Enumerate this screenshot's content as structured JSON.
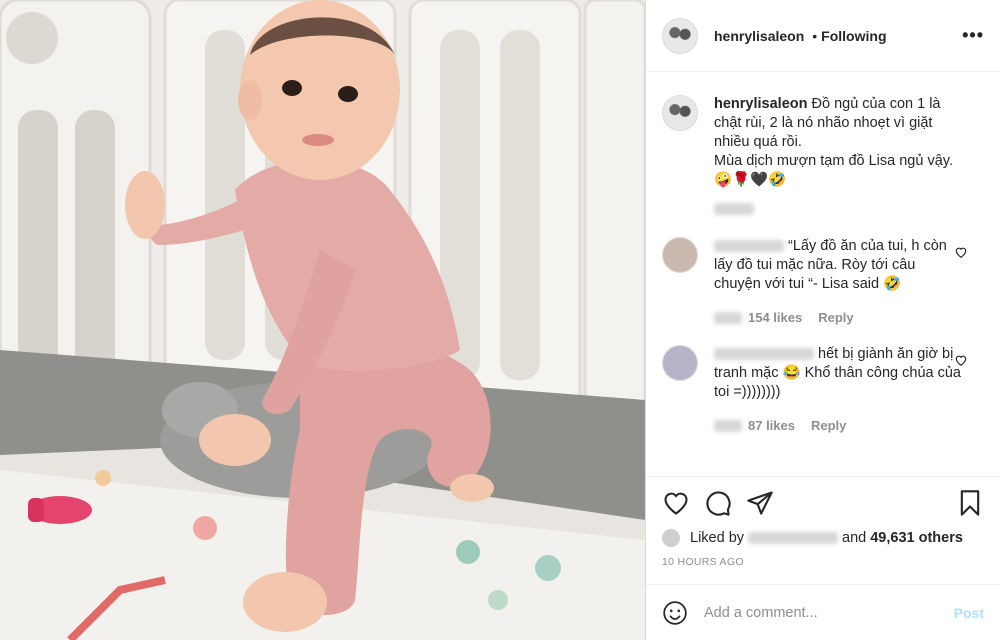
{
  "post": {
    "username": "henrylisaleon",
    "follow_separator": "•",
    "follow_status": "Following",
    "more_label": "•••"
  },
  "caption": {
    "username": "henrylisaleon",
    "text": "Đồ ngủ của con 1 là chật rùi, 2 là nó nhão nhoẹt vì giặt nhiều quá rồi.",
    "text2": "Mùa dịch mượn tạm đồ Lisa ngủ vậy.🤪🌹🖤🤣"
  },
  "comments": [
    {
      "text": "“Lấy đồ ăn của tui, h còn lấy đồ tui mặc nữa. Ròy tới câu chuyện với tui “- Lisa said 🤣",
      "likes": "154 likes",
      "reply_label": "Reply"
    },
    {
      "text": "hết bị giành ăn giờ bị tranh mặc 😂 Khổ thân công chúa của toi =))))))))",
      "likes": "87 likes",
      "reply_label": "Reply"
    }
  ],
  "likes_line": {
    "prefix": "Liked by",
    "connector": "and",
    "others": "49,631 others"
  },
  "timestamp": "10 HOURS AGO",
  "add_comment": {
    "placeholder": "Add a comment...",
    "post_label": "Post"
  },
  "colors": {
    "text": "#262626",
    "muted": "#8e8e8e",
    "border": "#dbdbdb",
    "post_disabled": "#b2dffc",
    "outfit": "#e0a39f"
  },
  "icons": [
    "heart-icon",
    "comment-icon",
    "share-icon",
    "bookmark-icon",
    "emoji-icon",
    "more-icon"
  ]
}
